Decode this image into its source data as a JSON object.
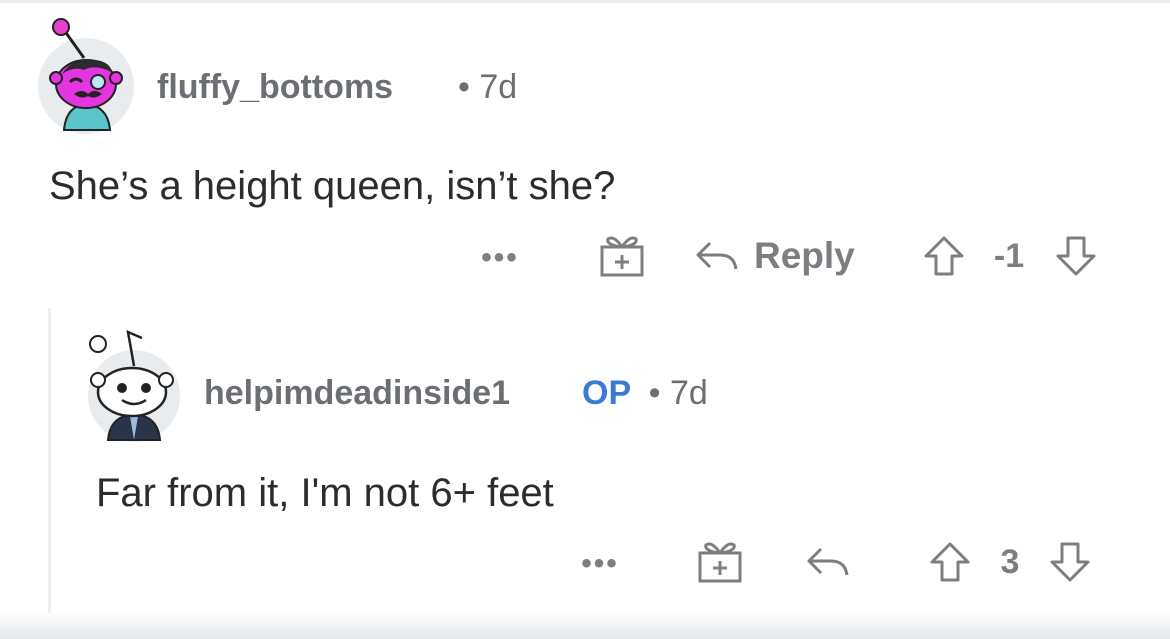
{
  "comments": [
    {
      "username": "fluffy_bottoms",
      "separator": "•",
      "age": "7d",
      "body": "She’s a height queen, isn’t she?",
      "actions": {
        "more": "•••",
        "reply_label": "Reply",
        "score": "-1"
      },
      "icons": [
        "more-icon",
        "gift-icon",
        "reply-icon",
        "upvote-icon",
        "downvote-icon"
      ]
    },
    {
      "username": "helpimdeadinside1",
      "op_badge": "OP",
      "separator": "•",
      "age": "7d",
      "body": "Far from it, I'm not 6+ feet",
      "actions": {
        "more": "•••",
        "score": "3"
      },
      "icons": [
        "more-icon",
        "gift-icon",
        "reply-icon",
        "upvote-icon",
        "downvote-icon"
      ]
    }
  ],
  "colors": {
    "text": "#2a2c2e",
    "meta": "#6b6e72",
    "op": "#3a7bd5",
    "icon": "#7c7f82"
  }
}
